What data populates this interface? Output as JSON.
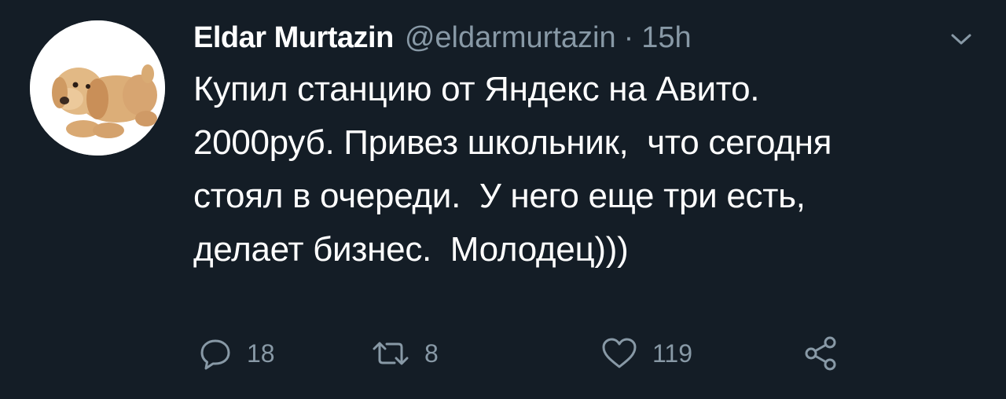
{
  "tweet": {
    "author": {
      "display_name": "Eldar Murtazin",
      "handle": "@eldarmurtazin",
      "avatar": "plush-puppy-avatar"
    },
    "separator": "·",
    "time": "15h",
    "text_lines": [
      "Купил станцию от Яндекс на Авито.",
      "2000руб. Привез школьник,  что сегодня",
      "стоял в очереди.  У него еще три есть,",
      "делает бизнес.  Молодец)))"
    ],
    "actions": {
      "reply": {
        "icon": "reply-icon",
        "count": "18"
      },
      "retweet": {
        "icon": "retweet-icon",
        "count": "8"
      },
      "like": {
        "icon": "heart-icon",
        "count": "119"
      },
      "share": {
        "icon": "share-icon"
      }
    },
    "menu_icon": "chevron-down-icon"
  },
  "colors": {
    "background": "#141d26",
    "primary_text": "#ffffff",
    "secondary_text": "#8899a6"
  }
}
